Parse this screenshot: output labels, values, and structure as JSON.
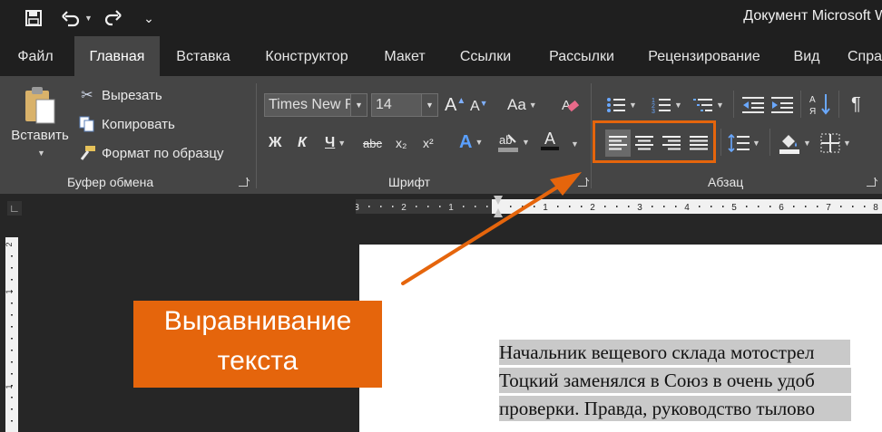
{
  "titlebar": {
    "document_title": "Документ Microsoft Word",
    "qa_dropdown_glyph": "⌄"
  },
  "tabs": [
    {
      "label": "Файл",
      "active": false
    },
    {
      "label": "Главная",
      "active": true
    },
    {
      "label": "Вставка",
      "active": false
    },
    {
      "label": "Конструктор",
      "active": false
    },
    {
      "label": "Макет",
      "active": false
    },
    {
      "label": "Ссылки",
      "active": false
    },
    {
      "label": "Рассылки",
      "active": false
    },
    {
      "label": "Рецензирование",
      "active": false
    },
    {
      "label": "Вид",
      "active": false
    },
    {
      "label": "Спра",
      "active": false
    }
  ],
  "clipboard": {
    "group_label": "Буфер обмена",
    "paste_label": "Вставить",
    "cut_label": "Вырезать",
    "copy_label": "Копировать",
    "format_painter_label": "Формат по образцу"
  },
  "font": {
    "group_label": "Шрифт",
    "font_name": "Times New R",
    "font_size": "14",
    "case_label": "Aa",
    "bold_label": "Ж",
    "italic_label": "К",
    "underline_label": "Ч",
    "strike_label": "abc",
    "subscript_label": "x₂",
    "superscript_label": "x²",
    "grow_label": "A",
    "shrink_label": "A",
    "text_effects_label": "A",
    "font_color_label": "A"
  },
  "paragraph": {
    "group_label": "Абзац",
    "pilcrow": "¶"
  },
  "ruler": {
    "labels": [
      "3",
      "2",
      "1",
      "1",
      "1",
      "2",
      "3",
      "4",
      "5",
      "6",
      "7",
      "8"
    ],
    "tab_selector": "∟"
  },
  "vruler": {
    "labels": [
      "2",
      "1",
      "1"
    ]
  },
  "document": {
    "lines": [
      "Начальник вещевого склада мотострел",
      "Тоцкий заменялся в Союз в очень удоб",
      "проверки. Правда, руководство тылово"
    ]
  },
  "callout": {
    "line1": "Выравнивание",
    "line2": "текста"
  },
  "colors": {
    "accent_orange": "#e5650c",
    "ribbon": "#454545",
    "titlebar": "#1f1f1f",
    "selection": "#c9c9c9"
  },
  "icons": [
    "save-icon",
    "undo-icon",
    "redo-icon",
    "paste-icon",
    "cut-icon",
    "copy-icon",
    "format-painter-icon",
    "clear-formatting-icon",
    "bullets-icon",
    "numbering-icon",
    "multilevel-list-icon",
    "decrease-indent-icon",
    "increase-indent-icon",
    "sort-icon",
    "pilcrow-icon",
    "align-left-icon",
    "align-center-icon",
    "align-right-icon",
    "justify-icon",
    "line-spacing-icon",
    "shading-icon",
    "borders-icon"
  ]
}
